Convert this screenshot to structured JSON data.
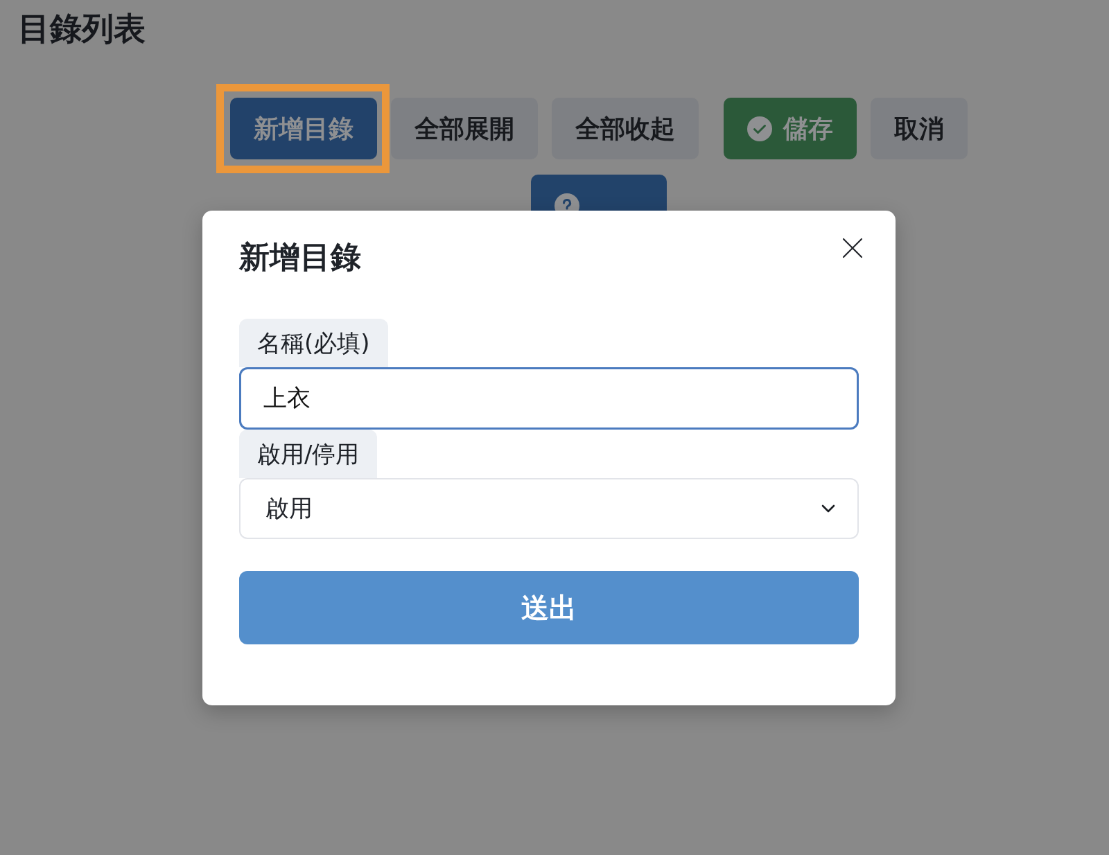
{
  "page": {
    "title": "目錄列表"
  },
  "toolbar": [
    {
      "label": "新增目錄",
      "kind": "primary",
      "highlighted": true
    },
    {
      "label": "全部展開",
      "kind": "plain",
      "highlighted": false
    },
    {
      "label": "全部收起",
      "kind": "plain",
      "highlighted": false
    },
    {
      "label": "儲存",
      "kind": "confirm",
      "highlighted": false
    },
    {
      "label": "取消",
      "kind": "plain",
      "highlighted": false
    },
    {
      "kind": "help",
      "highlighted": false
    }
  ],
  "dialog": {
    "title": "新增目錄",
    "fields": [
      {
        "kind": "text",
        "label": "名稱(必填)",
        "value": "上衣",
        "focused": true
      },
      {
        "kind": "select",
        "label": "啟用/停用",
        "value": "啟用",
        "focused": false
      }
    ],
    "submit": "送出"
  }
}
